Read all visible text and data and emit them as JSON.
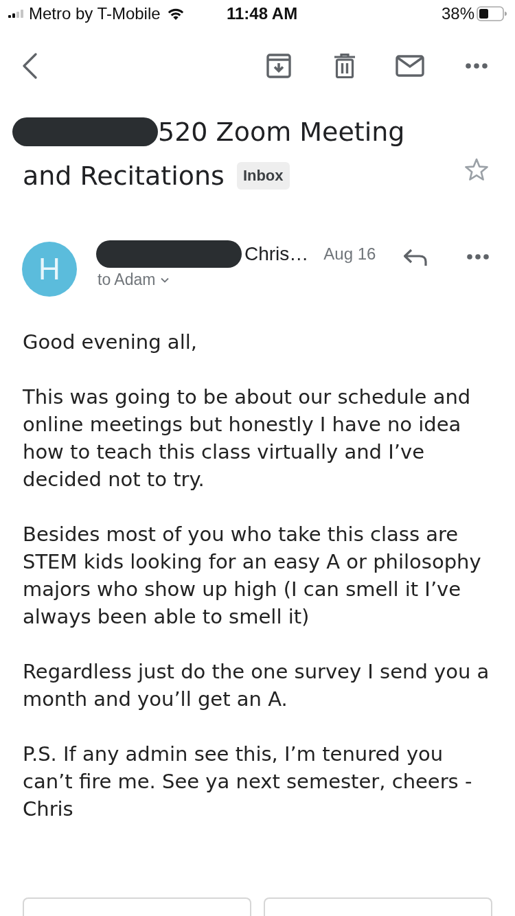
{
  "status_bar": {
    "carrier": "Metro by T-Mobile",
    "time": "11:48 AM",
    "battery": "38%"
  },
  "subject": {
    "redacted_prefix": true,
    "lines": [
      "520 Zoom Meeting",
      "and Recitations"
    ],
    "label": "Inbox",
    "starred": false
  },
  "message": {
    "avatar_letter": "H",
    "sender_redacted": true,
    "sender": "Chris…",
    "date": "Aug 16",
    "recipient": "to Adam"
  },
  "body": [
    "Good evening all,",
    "This was going to be about our schedule and online meetings but honestly I have no idea how to teach this class virtually and I’ve decided not to try.",
    "Besides most of you who take this class are STEM kids looking for an easy A or philosophy majors who show up high (I can smell it I’ve always been able to smell it)",
    "Regardless just do the one survey I send you a month and you’ll get an A.",
    "P.S. If any admin see this, I’m tenured you can’t fire me. See ya next semester, cheers - Chris"
  ]
}
